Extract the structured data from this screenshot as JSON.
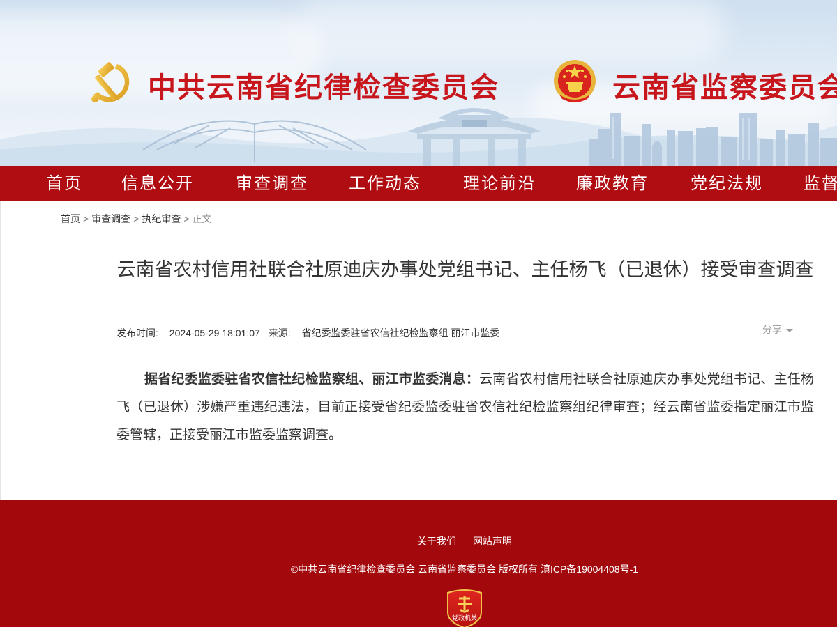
{
  "header": {
    "title_left": "中共云南省纪律检查委员会",
    "title_right": "云南省监察委员会",
    "party_logo_icon": "hammer-sickle-icon",
    "emblem_icon": "national-emblem-icon"
  },
  "nav": {
    "items": [
      {
        "label": "首页"
      },
      {
        "label": "信息公开"
      },
      {
        "label": "审查调查"
      },
      {
        "label": "工作动态"
      },
      {
        "label": "理论前沿"
      },
      {
        "label": "廉政教育"
      },
      {
        "label": "党纪法规"
      },
      {
        "label": "监督"
      }
    ]
  },
  "breadcrumb": {
    "items": [
      "首页",
      "审查调查",
      "执纪审查"
    ],
    "separator": ">",
    "current": "正文"
  },
  "article": {
    "title": "云南省农村信用社联合社原迪庆办事处党组书记、主任杨飞（已退休）接受审查调查",
    "publish_label": "发布时间:",
    "publish_time": "2024-05-29 18:01:07",
    "source_label": "来源:",
    "source": "省纪委监委驻省农信社纪检监察组 丽江市监委",
    "share_label": "分享",
    "lead_bold": "据省纪委监委驻省农信社纪检监察组、丽江市监委消息：",
    "body": "云南省农村信用社联合社原迪庆办事处党组书记、主任杨飞（已退休）涉嫌严重违纪违法，目前正接受省纪委监委驻省农信社纪检监察组纪律审查；经云南省监委指定丽江市监委管辖，正接受丽江市监委监察调查。"
  },
  "footer": {
    "links": [
      {
        "label": "关于我们"
      },
      {
        "label": "网站声明"
      }
    ],
    "copyright": "©中共云南省纪律检查委员会 云南省监察委员会 版权所有 滇ICP备19004408号-1",
    "badge_text": "党政机关",
    "badge_icon": "party-government-badge-icon"
  },
  "colors": {
    "brand_red": "#b00d12",
    "footer_red": "#a3080d",
    "title_red": "#c8161d"
  }
}
